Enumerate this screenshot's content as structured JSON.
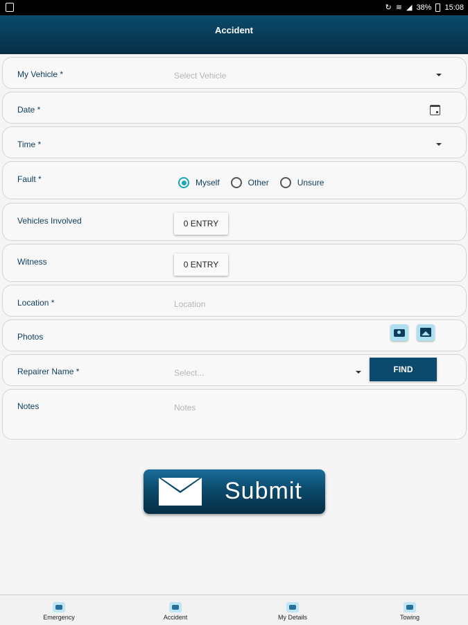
{
  "status_bar": {
    "battery": "38%",
    "time": "15:08"
  },
  "app_bar": {
    "title": "Accident"
  },
  "form": {
    "my_vehicle": {
      "label": "My Vehicle *",
      "placeholder": "Select Vehicle"
    },
    "date": {
      "label": "Date *"
    },
    "time": {
      "label": "Time *"
    },
    "fault": {
      "label": "Fault *",
      "options": [
        "Myself",
        "Other",
        "Unsure"
      ],
      "selected": "Myself"
    },
    "vehicles_involved": {
      "label": "Vehicles Involved",
      "button": "0 ENTRY"
    },
    "witness": {
      "label": "Witness",
      "button": "0 ENTRY"
    },
    "location": {
      "label": "Location *",
      "placeholder": "Location"
    },
    "photos": {
      "label": "Photos"
    },
    "repairer": {
      "label": "Repairer Name *",
      "placeholder": "Select...",
      "button": "FIND"
    },
    "notes": {
      "label": "Notes",
      "placeholder": "Notes"
    }
  },
  "submit": {
    "label": "Submit"
  },
  "bottom_nav": [
    {
      "label": "Emergency",
      "icon": "phone-icon"
    },
    {
      "label": "Accident",
      "icon": "crash-icon"
    },
    {
      "label": "My Details",
      "icon": "clipboard-icon"
    },
    {
      "label": "Towing",
      "icon": "tow-truck-icon"
    }
  ],
  "colors": {
    "primary": "#0b4a6c",
    "accent": "#1aa5b8"
  }
}
